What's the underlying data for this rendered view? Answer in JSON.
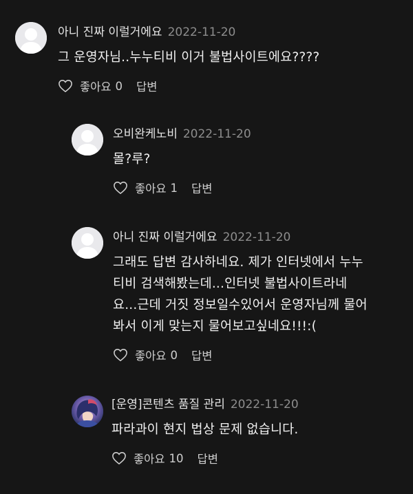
{
  "comments": [
    {
      "author": "아니 진짜 이럴거에요",
      "date": "2022-11-20",
      "text": "그 운영자님..누누티비 이거 불법사이트에요????",
      "like_label": "좋아요",
      "like_count": "0",
      "reply_label": "답변",
      "avatar": "default-user-avatar"
    },
    {
      "author": "오비완케노비",
      "date": "2022-11-20",
      "text": "몰?루?",
      "like_label": "좋아요",
      "like_count": "1",
      "reply_label": "답변",
      "avatar": "default-user-avatar"
    },
    {
      "author": "아니 진짜 이럴거에요",
      "date": "2022-11-20",
      "text_lines": [
        "그래도 답변 감사하네요. 제가 인터넷에서 누누",
        "티비 검색해봤는데...인터넷 불법사이트라네",
        "요...근데 거짓 정보일수있어서 운영자님께 물어",
        "봐서 이게 맞는지 물어보고싶네요!!!:("
      ],
      "like_label": "좋아요",
      "like_count": "0",
      "reply_label": "답변",
      "avatar": "default-user-avatar"
    },
    {
      "author": "[운영]콘텐츠 품질 관리",
      "date": "2022-11-20",
      "text": "파라과이 현지 법상 문제 없습니다.",
      "like_label": "좋아요",
      "like_count": "10",
      "reply_label": "답변",
      "avatar": "illustrated-character-avatar"
    }
  ],
  "colors": {
    "background": "#161616",
    "text": "#f0f0f0",
    "date": "#8d8d8d",
    "avatar_default": "#e9e9ec"
  }
}
